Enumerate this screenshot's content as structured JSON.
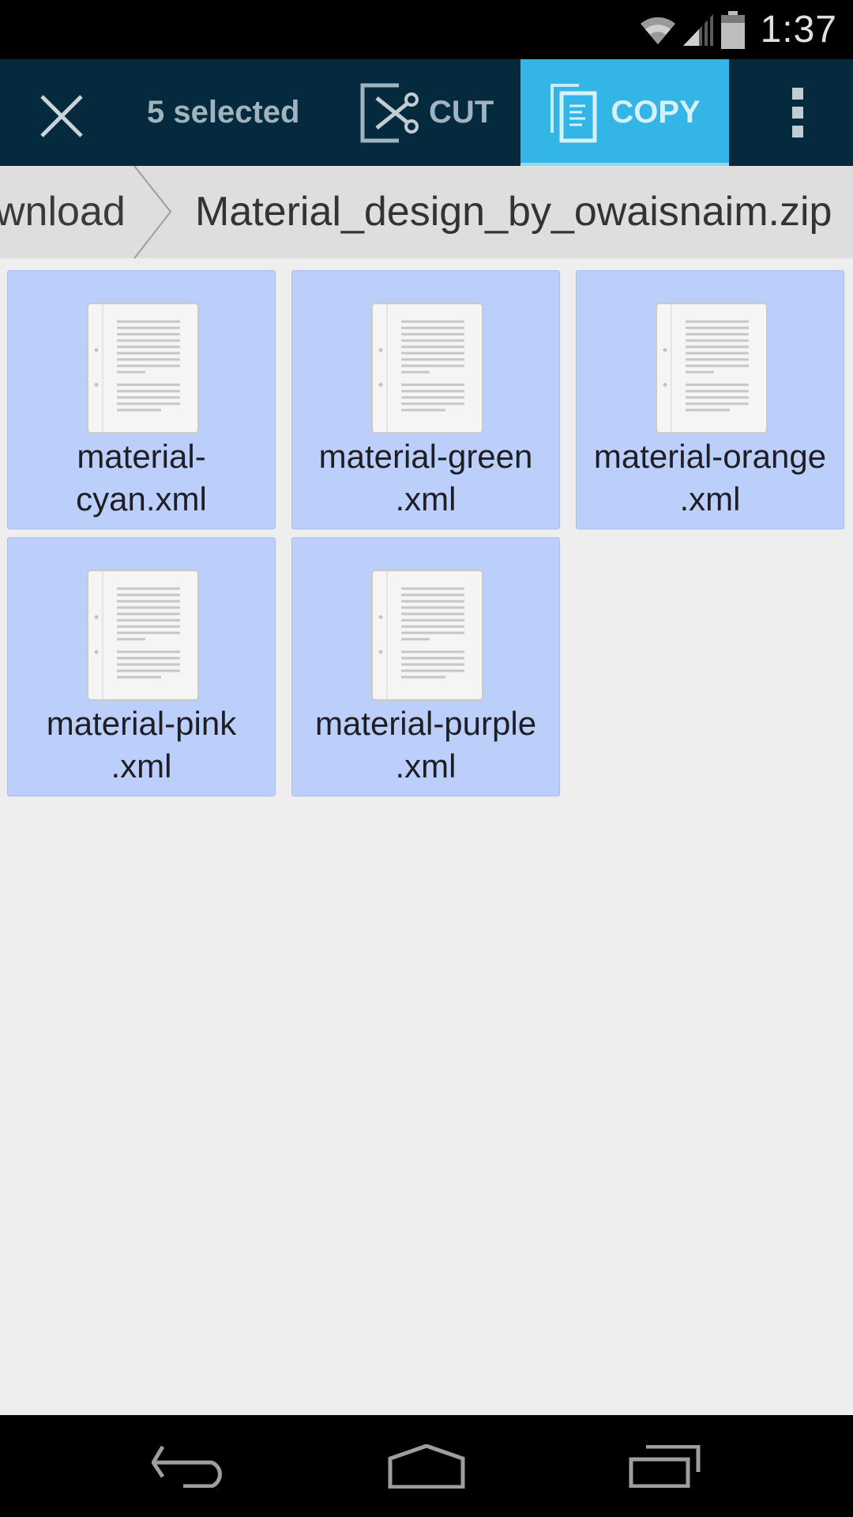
{
  "status_bar": {
    "time": "1:37",
    "icons": [
      "wifi-icon",
      "cell-signal-icon",
      "battery-icon"
    ]
  },
  "action_bar": {
    "close_icon": "close-icon",
    "selected_label": "5 selected",
    "cut_label": "CUT",
    "copy_label": "COPY",
    "overflow_icon": "more-vert-icon",
    "colors": {
      "bar_bg": "#052a3e",
      "copy_active_bg": "#33b5e5"
    }
  },
  "breadcrumb": {
    "previous": "wnload",
    "current": "Material_design_by_owaisnaim.zip"
  },
  "files": [
    {
      "name_line1": "material-",
      "name_line2": "cyan.xml",
      "selected": true
    },
    {
      "name_line1": "material-green",
      "name_line2": ".xml",
      "selected": true
    },
    {
      "name_line1": "material-orange",
      "name_line2": ".xml",
      "selected": true
    },
    {
      "name_line1": "material-pink",
      "name_line2": ".xml",
      "selected": true
    },
    {
      "name_line1": "material-purple",
      "name_line2": ".xml",
      "selected": true
    }
  ],
  "nav_bar": {
    "back": "back-icon",
    "home": "home-icon",
    "recents": "recents-icon"
  }
}
